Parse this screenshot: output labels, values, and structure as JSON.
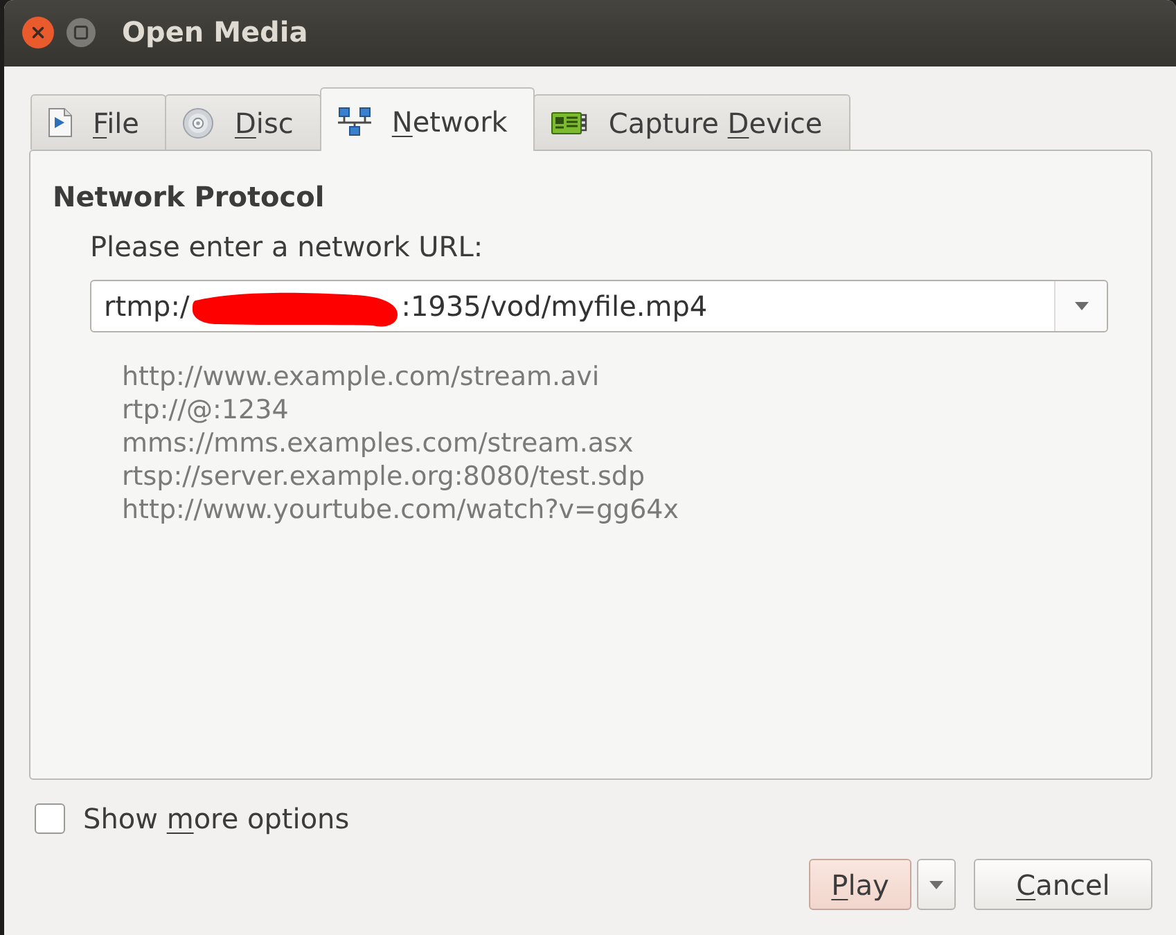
{
  "window": {
    "title": "Open Media",
    "buttons": [
      {
        "kind": "close"
      },
      {
        "kind": "maximize"
      }
    ]
  },
  "tabs": [
    {
      "kind": "file",
      "label": {
        "key": "F",
        "after": "ile"
      },
      "selected": false
    },
    {
      "kind": "disc",
      "label": {
        "key": "D",
        "after": "isc"
      },
      "selected": false
    },
    {
      "kind": "network",
      "label": {
        "key": "N",
        "after": "etwork"
      },
      "selected": true
    },
    {
      "kind": "capture",
      "label": {
        "before": "Capture ",
        "key": "D",
        "after": "evice"
      },
      "selected": false
    }
  ],
  "panel": {
    "heading": "Network Protocol",
    "prompt": "Please enter a network URL:",
    "url_field": {
      "value_start": "rtmp:/",
      "redacted": true,
      "value_end": ":1935/vod/myfile.mp4"
    },
    "examples": [
      "http://www.example.com/stream.avi",
      "rtp://@:1234",
      "mms://mms.examples.com/stream.asx",
      "rtsp://server.example.org:8080/test.sdp",
      "http://www.yourtube.com/watch?v=gg64x"
    ]
  },
  "show_more_options": {
    "label": {
      "before": "Show ",
      "key": "m",
      "after": "ore options"
    },
    "checked": false
  },
  "buttons": [
    {
      "kind": "primary",
      "label": {
        "key": "P",
        "after": "lay"
      }
    },
    {
      "kind": "menu"
    },
    {
      "kind": "normal",
      "label": {
        "key": "C",
        "after": "ancel"
      }
    }
  ]
}
